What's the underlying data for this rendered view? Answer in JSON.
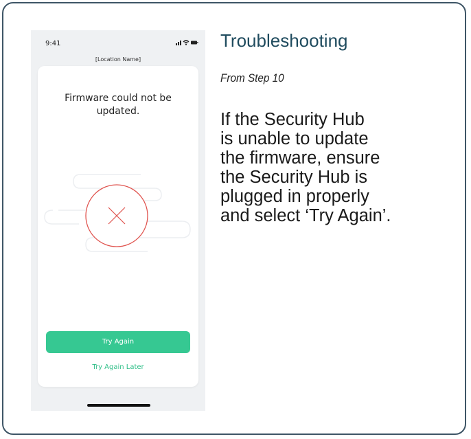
{
  "phone": {
    "time": "9:41",
    "location": "[Location Name]",
    "card_title": "Firmware could not be updated.",
    "primary_button": "Try Again",
    "secondary_link": "Try Again Later",
    "colors": {
      "accent_green": "#36c892",
      "error_red": "#e0544f"
    }
  },
  "side": {
    "heading": "Troubleshooting",
    "subheading": "From Step 10",
    "body_lines": [
      "If  the  Security  Hub",
      "is unable to update",
      "the firmware, ensure",
      "the Security Hub is",
      "plugged in properly",
      "and select ‘Try Again’."
    ]
  }
}
